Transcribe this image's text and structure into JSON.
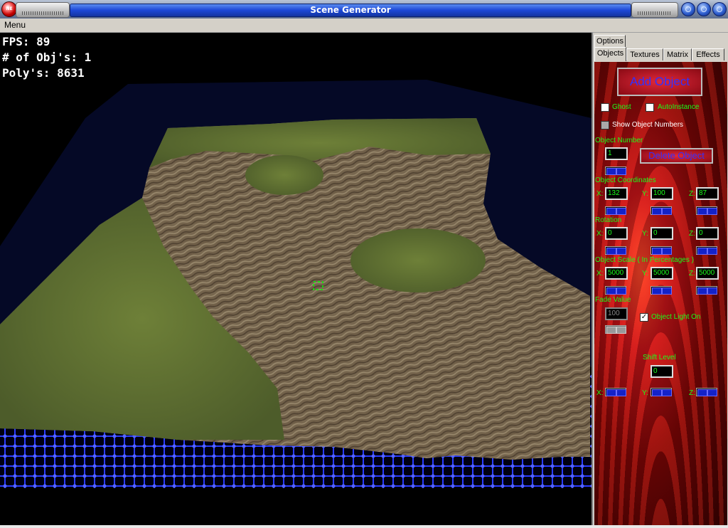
{
  "window": {
    "title": "Scene Generator",
    "icon": "app-logo-icon",
    "icon_text": "NE"
  },
  "menu": {
    "label": "Menu"
  },
  "hud": {
    "fps": "FPS: 89",
    "objects": "# of Obj's: 1",
    "polys": "Poly's: 8631"
  },
  "tabs": {
    "top": [
      "Options"
    ],
    "bottom": [
      "Objects",
      "Textures",
      "Matrix",
      "Effects"
    ],
    "active": "Objects"
  },
  "objects_panel": {
    "add_button": "Add Object",
    "ghost_label": "Ghost",
    "autoinstance_label": "AutoInstance",
    "show_numbers_label": "Show Object Numbers",
    "object_number_label": "Object Number",
    "object_number_value": "1",
    "delete_button": "Delete Object",
    "coordinates_label": "Object Coordinates",
    "coordinates": {
      "x": "132",
      "y": "100",
      "z": "87"
    },
    "rotation_label": "Rotation",
    "rotation": {
      "x": "0",
      "y": "0",
      "z": "0"
    },
    "scale_label": "Object Scale ( In Percentages )",
    "scale": {
      "x": "5000",
      "y": "5000",
      "z": "5000"
    },
    "fade_label": "Fade Value",
    "fade_value": "100",
    "light_label": "Object Light On",
    "light_checked": true,
    "shift_label": "Shift Level",
    "shift_value": "0",
    "axis": {
      "x": "X:",
      "y": "Y:",
      "z": "Z:"
    }
  },
  "colors": {
    "panel_text": "#1aff1a",
    "accent_blue": "#1c47d6",
    "panel_red": "#c8151a",
    "grid_blue": "#2a3cff"
  }
}
